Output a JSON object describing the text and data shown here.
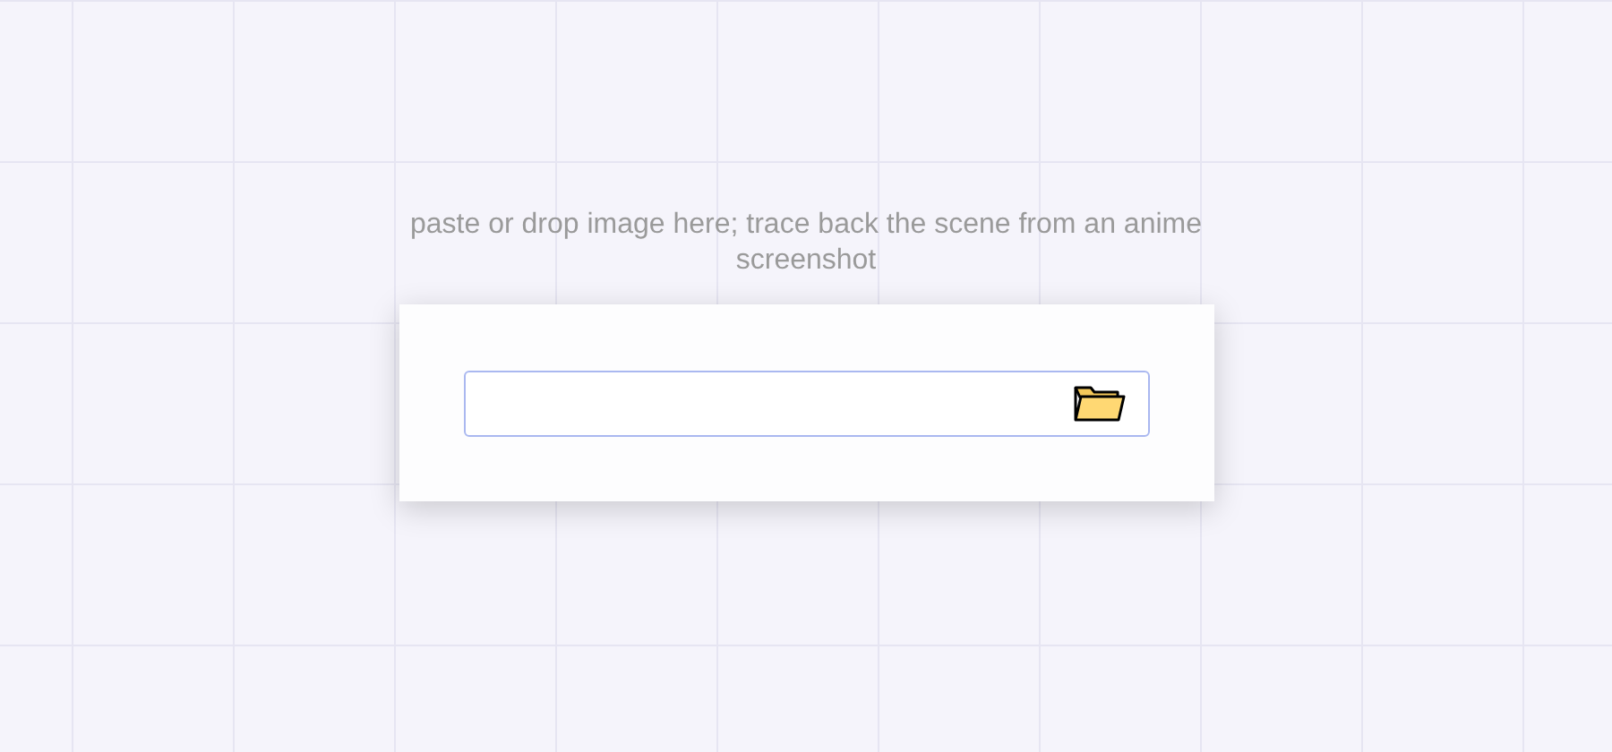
{
  "hint": "paste or drop image here; trace back the scene from an anime screenshot",
  "url_field": {
    "kind": "input"
  }
}
